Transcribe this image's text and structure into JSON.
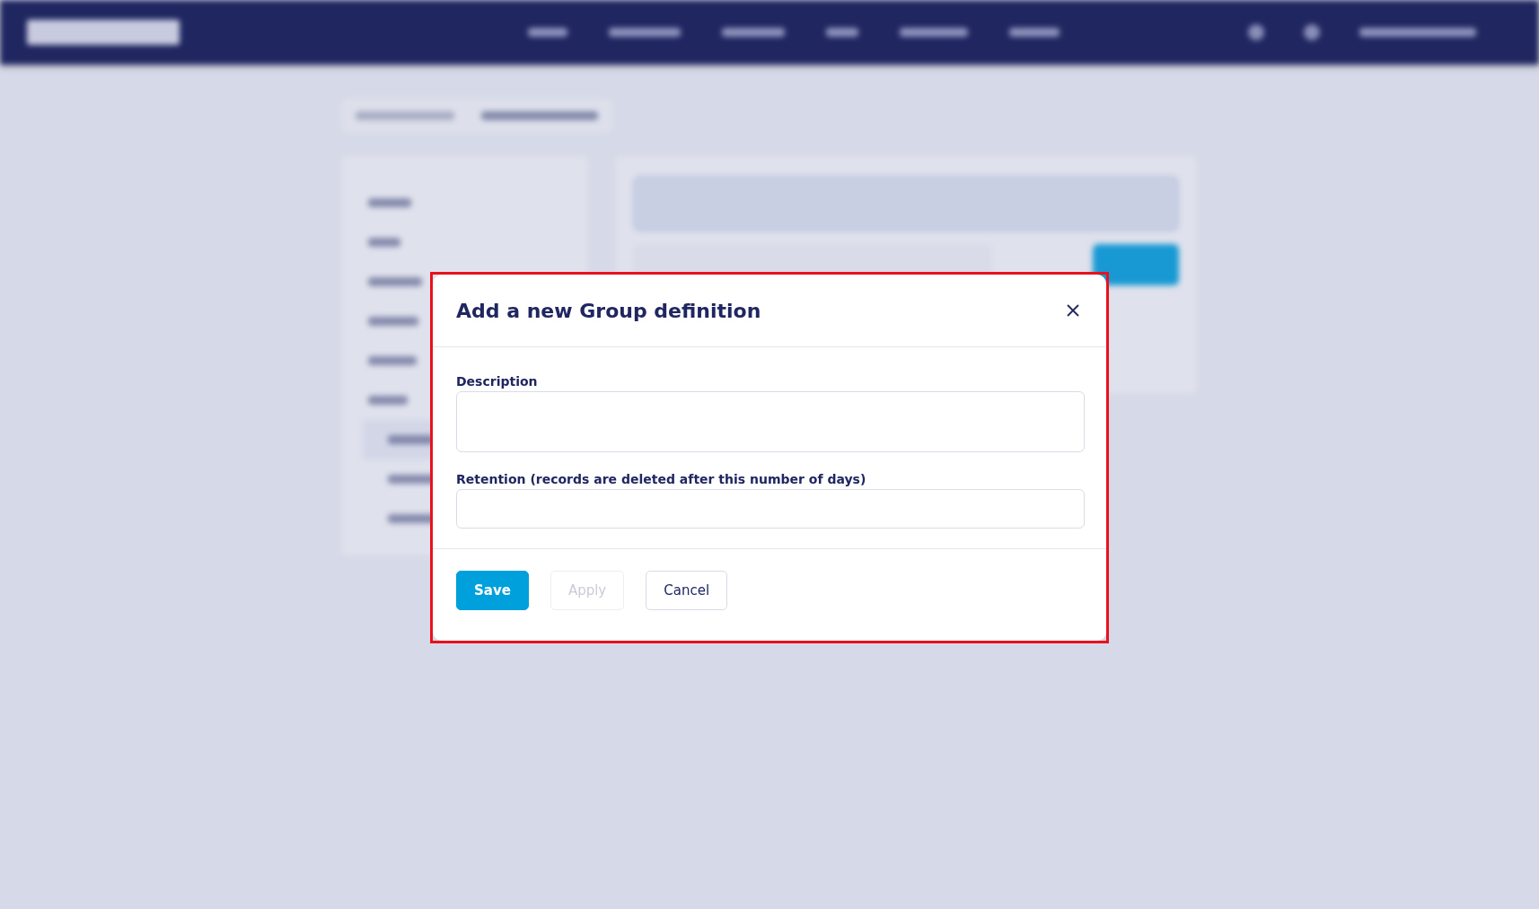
{
  "dialog": {
    "title": "Add a new Group definition",
    "fields": [
      {
        "label": "Description",
        "kind": "textarea"
      },
      {
        "label": "Retention (records are deleted after this number of days)",
        "kind": "input"
      }
    ],
    "buttons": [
      {
        "label": "Save",
        "kind": "primary",
        "disabled": false
      },
      {
        "label": "Apply",
        "kind": "secondary",
        "disabled": true
      },
      {
        "label": "Cancel",
        "kind": "secondary",
        "disabled": false
      }
    ]
  }
}
